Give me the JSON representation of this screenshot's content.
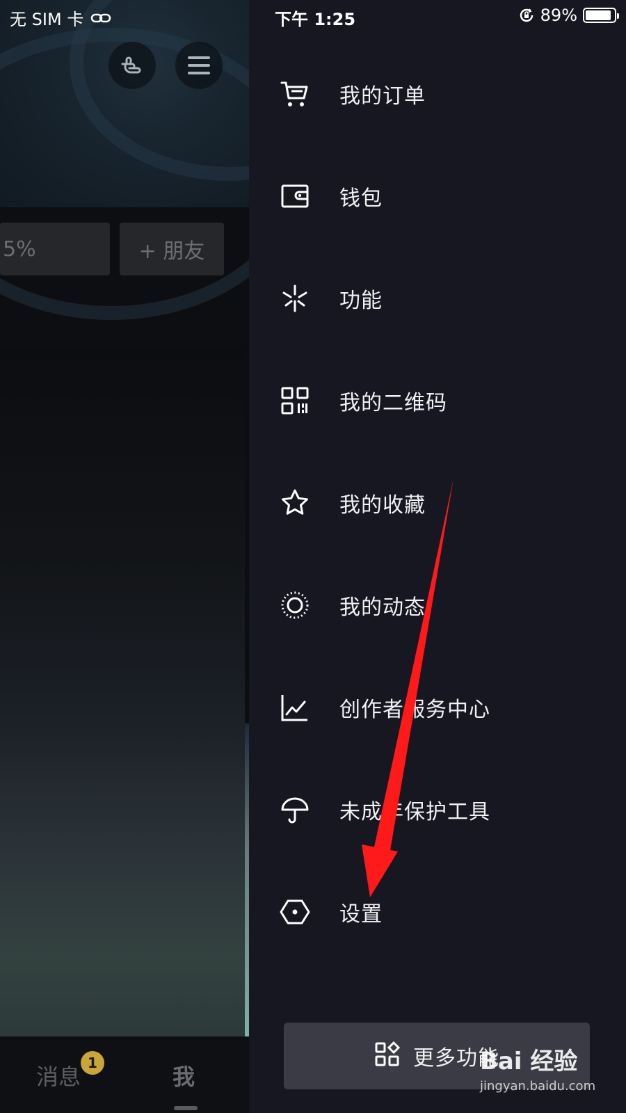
{
  "status_bar": {
    "carrier": "无 SIM 卡",
    "time": "下午 1:25",
    "battery_percent": "89%",
    "battery_level": 0.89
  },
  "background_page": {
    "chip_percent": "5%",
    "add_friend": "+ 朋友",
    "tabs": {
      "messages": "消息",
      "me": "我"
    },
    "message_badge": "1"
  },
  "drawer": {
    "items": [
      {
        "label": "我的订单",
        "icon": "cart-icon"
      },
      {
        "label": "钱包",
        "icon": "wallet-icon"
      },
      {
        "label": "功能",
        "icon": "sparkle-icon"
      },
      {
        "label": "我的二维码",
        "icon": "qrcode-icon"
      },
      {
        "label": "我的收藏",
        "icon": "star-icon"
      },
      {
        "label": "我的动态",
        "icon": "moments-icon"
      },
      {
        "label": "创作者服务中心",
        "icon": "chart-icon"
      },
      {
        "label": "未成年保护工具",
        "icon": "umbrella-icon"
      },
      {
        "label": "设置",
        "icon": "settings-hex-icon"
      }
    ],
    "more_button": {
      "label": "更多功能",
      "icon": "grid-icon"
    }
  },
  "annotation": {
    "arrow_color": "#ff0000"
  },
  "watermark": {
    "logo": "Bai 经验",
    "url": "jingyan.baidu.com"
  },
  "colors": {
    "drawer_bg": "#161721",
    "more_button_bg": "#3a3b45",
    "badge": "#c9a53a"
  }
}
